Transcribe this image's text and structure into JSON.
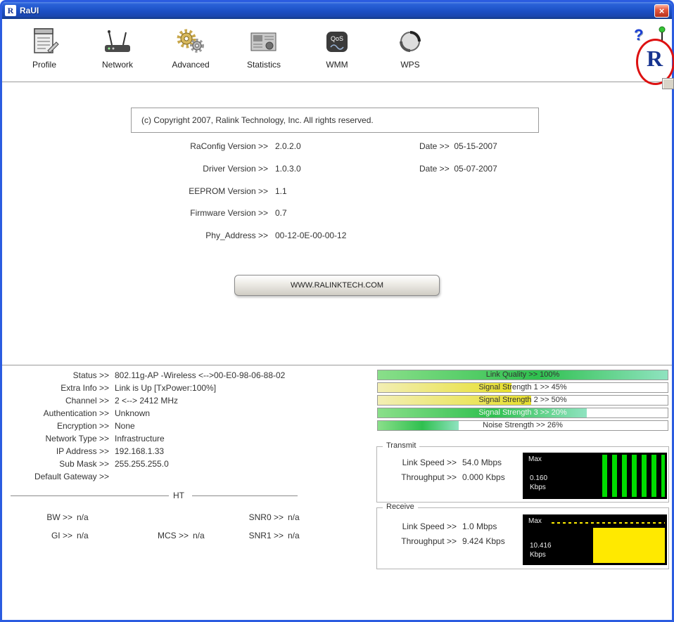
{
  "window": {
    "title": "RaUI"
  },
  "icons": {
    "close": "×",
    "help": "?",
    "logo": "R"
  },
  "toolbar": {
    "wmm_badge": "QoS",
    "items": [
      {
        "label": "Profile"
      },
      {
        "label": "Network"
      },
      {
        "label": "Advanced"
      },
      {
        "label": "Statistics"
      },
      {
        "label": "WMM"
      },
      {
        "label": "WPS"
      }
    ]
  },
  "about": {
    "copyright": "(c) Copyright 2007, Ralink Technology, Inc.  All rights reserved.",
    "rows": [
      {
        "label": "RaConfig Version >>",
        "value": "2.0.2.0",
        "date_label": "Date >>",
        "date": "05-15-2007"
      },
      {
        "label": "Driver Version >>",
        "value": "1.0.3.0",
        "date_label": "Date >>",
        "date": "05-07-2007"
      },
      {
        "label": "EEPROM Version >>",
        "value": "1.1"
      },
      {
        "label": "Firmware Version >>",
        "value": "0.7"
      },
      {
        "label": "Phy_Address >>",
        "value": "00-12-0E-00-00-12"
      }
    ],
    "website_button": "WWW.RALINKTECH.COM"
  },
  "status": {
    "rows": [
      {
        "label": "Status >>",
        "value": "802.11g-AP -Wireless  <-->00-E0-98-06-88-02"
      },
      {
        "label": "Extra Info >>",
        "value": "Link is Up [TxPower:100%]"
      },
      {
        "label": "Channel >>",
        "value": "2 <--> 2412 MHz"
      },
      {
        "label": "Authentication >>",
        "value": "Unknown"
      },
      {
        "label": "Encryption >>",
        "value": "None"
      },
      {
        "label": "Network Type >>",
        "value": "Infrastructure"
      },
      {
        "label": "IP Address >>",
        "value": "192.168.1.33"
      },
      {
        "label": "Sub Mask >>",
        "value": "255.255.255.0"
      },
      {
        "label": "Default Gateway >>",
        "value": ""
      }
    ],
    "ht": {
      "label": "HT",
      "bw": {
        "label": "BW >>",
        "value": "n/a"
      },
      "gi": {
        "label": "GI >>",
        "value": "n/a"
      },
      "mcs": {
        "label": "MCS >>",
        "value": "n/a"
      },
      "snr0": {
        "label": "SNR0 >>",
        "value": "n/a"
      },
      "snr1": {
        "label": "SNR1 >>",
        "value": "n/a"
      }
    }
  },
  "quality": {
    "bars": [
      {
        "text": "Link Quality >> 100%",
        "fill_percent": 100,
        "color": "green",
        "light_text": false
      },
      {
        "text": "Signal Strength 1 >> 45%",
        "fill_percent": 46,
        "color": "yellow",
        "light_text": false
      },
      {
        "text": "Signal Strength 2 >> 50%",
        "fill_percent": 53,
        "color": "yellow",
        "light_text": false
      },
      {
        "text": "Signal Strength 3 >> 20%",
        "fill_percent": 72,
        "color": "green",
        "light_text": true
      },
      {
        "text": "Noise Strength >> 26%",
        "fill_percent": 28,
        "color": "green",
        "light_text": false
      }
    ]
  },
  "transmit": {
    "title": "Transmit",
    "link_speed_label": "Link Speed >>",
    "link_speed": "54.0 Mbps",
    "throughput_label": "Throughput >>",
    "throughput": "0.000 Kbps",
    "chart": {
      "max_label": "Max",
      "scale_value": "0.160",
      "scale_unit": "Kbps"
    }
  },
  "receive": {
    "title": "Receive",
    "link_speed_label": "Link Speed >>",
    "link_speed": "1.0 Mbps",
    "throughput_label": "Throughput >>",
    "throughput": "9.424 Kbps",
    "chart": {
      "max_label": "Max",
      "scale_value": "10.416",
      "scale_unit": "Kbps"
    }
  },
  "colors": {
    "titlebar_blue": "#1b4fc4",
    "bar_green": "#2fc04f",
    "bar_yellow": "#e7df2e",
    "tx_chart_bars": "#00dc00",
    "rx_chart_fill": "#ffe900",
    "annotation_red": "#dd1111"
  }
}
